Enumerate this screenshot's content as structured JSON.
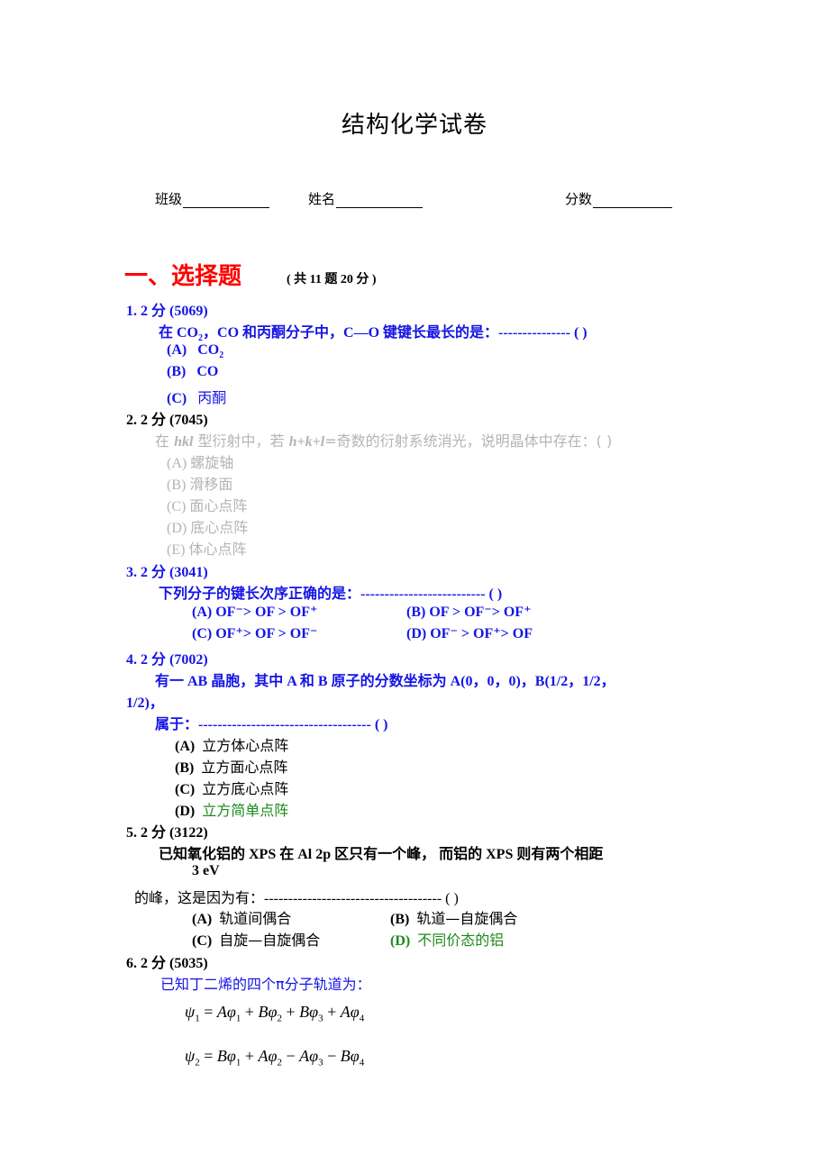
{
  "document": {
    "title": "结构化学试卷",
    "fields": [
      {
        "label": "班级"
      },
      {
        "label": "姓名"
      },
      {
        "label": "分数"
      }
    ]
  },
  "section": {
    "title": "一、选择题",
    "note": "( 共 11 题   20 分 )"
  },
  "colors": {
    "section_title": "#ff0000",
    "question_text": "#1414e6",
    "disabled_text": "#b4b4b4",
    "answer_highlight": "#1a8a1a"
  },
  "questions": [
    {
      "header": "1.   2  分  (5069)",
      "stem_pre": "在 CO",
      "stem_sub": "2",
      "stem_post": "，CO 和丙酮分子中，C—O 键键长最长的是：--------------- (      )",
      "options": [
        {
          "label": "(A)",
          "text": "CO",
          "sub": "2"
        },
        {
          "label": "(B)",
          "text": "CO"
        },
        {
          "label": "(C)",
          "text": "丙酮"
        }
      ]
    },
    {
      "header": "2.   2  分  (7045)",
      "stem_a": "在 ",
      "stem_hkl": "hkl",
      "stem_b": " 型衍射中，若 ",
      "stem_cond": "h+k+l",
      "stem_c": "=奇数的衍射系统消光，说明晶体中存在：(      )",
      "options": [
        {
          "label": "(A)",
          "text": "螺旋轴"
        },
        {
          "label": "(B)",
          "text": "滑移面"
        },
        {
          "label": "(C)",
          "text": "面心点阵"
        },
        {
          "label": "(D)",
          "text": "底心点阵"
        },
        {
          "label": "(E)",
          "text": "体心点阵"
        }
      ]
    },
    {
      "header": "3.   2  分  (3041)",
      "stem": "下列分子的键长次序正确的是：-------------------------- (      )",
      "options": [
        {
          "label": "(A)",
          "text": "OF⁻> OF > OF⁺"
        },
        {
          "label": "(B)",
          "text": "OF > OF⁻> OF⁺"
        },
        {
          "label": "(C)",
          "text": "OF⁺> OF > OF⁻"
        },
        {
          "label": "(D)",
          "text": "OF⁻ > OF⁺> OF"
        }
      ]
    },
    {
      "header": "4.   2  分  (7002)",
      "stem_line1": "有一 AB 晶胞，其中 A 和 B 原子的分数坐标为 A(0，0，0)，B(1/2，1/2，",
      "stem_line2": "1/2)，",
      "stem_line3": "属于：------------------------------------ (      )",
      "options": [
        {
          "label": "(A)",
          "text": "立方体心点阵"
        },
        {
          "label": "(B)",
          "text": "立方面心点阵"
        },
        {
          "label": "(C)",
          "text": "立方底心点阵"
        },
        {
          "label": "(D)",
          "text": "立方简单点阵",
          "highlight": true
        }
      ]
    },
    {
      "header": "5.   2  分  (3122)",
      "stem_line1": "已知氧化铝的  XPS  在  Al 2p  区只有一个峰，  而铝的  XPS  则有两个相距",
      "stem_line2": "3 eV",
      "stem_line3": "的峰，这是因为有：------------------------------------- (            )",
      "options": [
        {
          "label": "(A)",
          "text": "轨道间偶合"
        },
        {
          "label": "(B)",
          "text": "轨道—自旋偶合"
        },
        {
          "label": "(C)",
          "text": "自旋—自旋偶合"
        },
        {
          "label": "(D)",
          "text": "不同价态的铝",
          "highlight": true
        }
      ]
    },
    {
      "header": "6.   2  分  (5035)",
      "stem": "已知丁二烯的四个π分子轨道为：",
      "equations": [
        {
          "lhs": "ψ",
          "lhs_sub": "1",
          "terms": [
            {
              "sign": "=",
              "coef": "A",
              "idx": "1"
            },
            {
              "sign": "+",
              "coef": "B",
              "idx": "2"
            },
            {
              "sign": "+",
              "coef": "B",
              "idx": "3"
            },
            {
              "sign": "+",
              "coef": "A",
              "idx": "4"
            }
          ]
        },
        {
          "lhs": "ψ",
          "lhs_sub": "2",
          "terms": [
            {
              "sign": "=",
              "coef": "B",
              "idx": "1"
            },
            {
              "sign": "+",
              "coef": "A",
              "idx": "2"
            },
            {
              "sign": "−",
              "coef": "A",
              "idx": "3"
            },
            {
              "sign": "−",
              "coef": "B",
              "idx": "4"
            }
          ]
        }
      ]
    }
  ]
}
